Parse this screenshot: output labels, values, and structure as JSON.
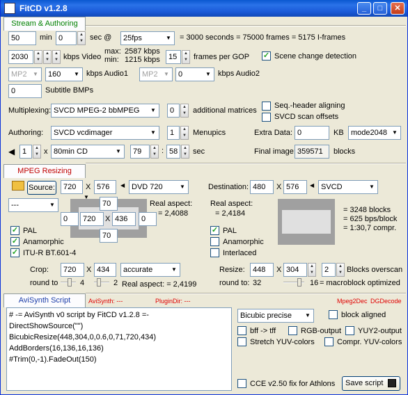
{
  "window": {
    "title": "FitCD v1.2.8",
    "minimize": "_",
    "maximize": "□",
    "close": "✕"
  },
  "stream": {
    "tab": "Stream & Authoring",
    "min_value": "50",
    "min_label": "min",
    "sec_value": "0",
    "sec_label": "sec @",
    "fps": "25fps",
    "summary": "= 3000 seconds = 75000 frames = 5175 I-frames",
    "video_kbps": "2030",
    "video_label": "kbps Video",
    "max_label": "max:",
    "max_value": "2587 kbps",
    "min2_label": "min:",
    "min2_value": "1215 kbps",
    "gop_value": "15",
    "gop_label": "frames per GOP",
    "scene_detect": "Scene change detection",
    "audio1_codec": "MP2",
    "audio1_kbps": "160",
    "audio1_label": "kbps Audio1",
    "audio2_codec": "MP2",
    "audio2_kbps": "0",
    "audio2_label": "kbps Audio2",
    "subtitle_value": "0",
    "subtitle_label": "Subtitle BMPs",
    "multiplexing_label": "Multiplexing:",
    "multiplexing_value": "SVCD MPEG-2 bbMPEG",
    "matrices_value": "0",
    "matrices_label": "additional matrices",
    "seq_header": "Seq.-header aligning",
    "scan_offsets": "SVCD scan offsets",
    "authoring_label": "Authoring:",
    "authoring_value": "SVCD vcdimager",
    "menupics_value": "1",
    "menupics_label": "Menupics",
    "extra_label": "Extra Data:",
    "extra_value": "0",
    "extra_unit": "KB",
    "mode": "mode2048",
    "disc_count": "1",
    "disc_x": "x",
    "disc_type": "80min CD",
    "disc_min": "79",
    "disc_sec": "58",
    "disc_sec_label": "sec",
    "final_label": "Final image:",
    "final_value": "359571",
    "final_unit": "blocks"
  },
  "resize": {
    "tab": "MPEG Resizing",
    "source_label": "Source:",
    "src_w": "720",
    "src_x": "X",
    "src_h": "576",
    "src_format": "DVD 720",
    "src_preset": "---",
    "src_top": "70",
    "src_left": "0",
    "src_w2": "720",
    "src_x2": "X",
    "src_h2": "436",
    "src_right": "0",
    "src_bottom": "70",
    "real_aspect_label": "Real aspect:",
    "real_aspect_src": "= 2,4088",
    "pal": "PAL",
    "anamorphic": "Anamorphic",
    "itu": "ITU-R BT.601-4",
    "crop_label": "Crop:",
    "crop_w": "720",
    "crop_x": "X",
    "crop_h": "434",
    "crop_mode": "accurate",
    "round_label": "round to",
    "round_val1": "4",
    "round_val2": "2",
    "real_aspect_crop": "Real aspect: = 2,4199",
    "dest_label": "Destination:",
    "dst_w": "480",
    "dst_x": "X",
    "dst_h": "576",
    "dst_format": "SVCD",
    "dst_real_aspect_label": "Real aspect:",
    "dst_real_aspect": "= 2,4184",
    "dst_pal": "PAL",
    "dst_anamorphic": "Anamorphic",
    "dst_interlaced": "Interlaced",
    "blocks": "= 3248 blocks",
    "bps": "= 625 bps/block",
    "compr": "= 1:30,7 compr.",
    "resize_label": "Resize:",
    "rs_w": "448",
    "rs_x": "X",
    "rs_h": "304",
    "overscan_val": "2",
    "overscan_label": "Blocks overscan",
    "rs_round_label": "round to:",
    "rs_round_val": "32",
    "macro_val": "16",
    "macro_label": "= macroblock optimized"
  },
  "avisynth": {
    "tab": "AviSynth Script",
    "avisynth_path": "AviSynth: ---",
    "plugindir": "PluginDir: ---",
    "mpeg2dec": "Mpeg2Dec",
    "dgdecode": "DGDecode",
    "script": [
      "# -= AviSynth v0 script by FitCD v1.2.8 =-",
      "DirectShowSource(\"\")",
      "BicubicResize(448,304,0,0.6,0,71,720,434)",
      "AddBorders(16,136,16,136)",
      "#Trim(0,-1).FadeOut(150)"
    ],
    "resize_method": "Bicubic precise",
    "block_aligned": "block aligned",
    "bff": "bff -> tff",
    "rgb": "RGB-output",
    "yuy2": "YUY2-output",
    "stretch_yuv": "Stretch YUV-colors",
    "compr_yuv": "Compr. YUV-colors",
    "cce": "CCE v2.50 fix for Athlons",
    "save_script": "Save script"
  },
  "colors": {
    "title_bar": "#0a58d0",
    "tab_green": "#008000",
    "tab_red": "#c00000",
    "tab_blue": "#1a3ca8",
    "path_red": "#e00000"
  }
}
